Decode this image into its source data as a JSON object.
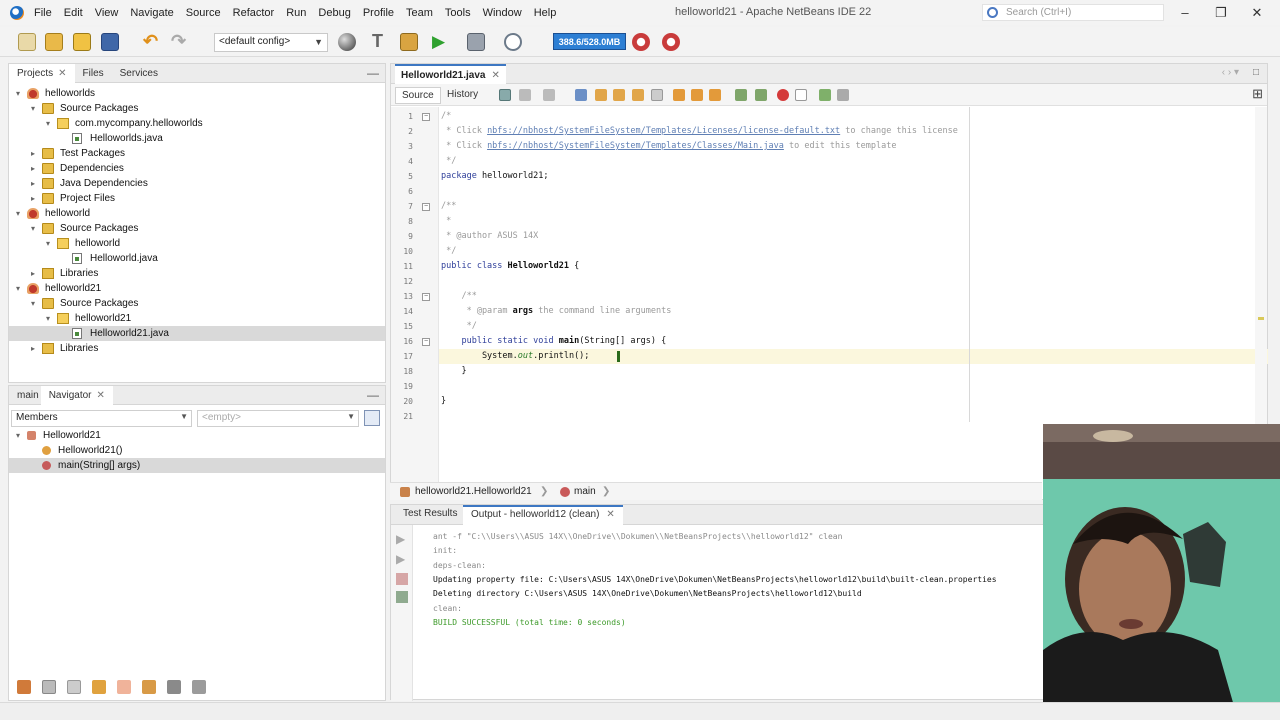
{
  "window": {
    "title": "helloworld21 - Apache NetBeans IDE 22",
    "search_placeholder": "Search (Ctrl+I)"
  },
  "menu": [
    "File",
    "Edit",
    "View",
    "Navigate",
    "Source",
    "Refactor",
    "Run",
    "Debug",
    "Profile",
    "Team",
    "Tools",
    "Window",
    "Help"
  ],
  "toolbar": {
    "config": "<default config>",
    "memory": "388.6/528.0MB"
  },
  "projects": {
    "tabs": [
      "Projects",
      "Files",
      "Services"
    ],
    "tree": [
      {
        "label": "helloworlds",
        "type": "proj",
        "depth": 0,
        "open": true
      },
      {
        "label": "Source Packages",
        "type": "folder",
        "depth": 1,
        "open": true
      },
      {
        "label": "com.mycompany.helloworlds",
        "type": "pkg",
        "depth": 2,
        "open": true
      },
      {
        "label": "Helloworlds.java",
        "type": "file",
        "depth": 3
      },
      {
        "label": "Test Packages",
        "type": "folder",
        "depth": 1,
        "open": false
      },
      {
        "label": "Dependencies",
        "type": "folder",
        "depth": 1,
        "open": false
      },
      {
        "label": "Java Dependencies",
        "type": "folder",
        "depth": 1,
        "open": false
      },
      {
        "label": "Project Files",
        "type": "folder",
        "depth": 1,
        "open": false
      },
      {
        "label": "helloworld",
        "type": "proj",
        "depth": 0,
        "open": true
      },
      {
        "label": "Source Packages",
        "type": "folder",
        "depth": 1,
        "open": true
      },
      {
        "label": "helloworld",
        "type": "pkg",
        "depth": 2,
        "open": true
      },
      {
        "label": "Helloworld.java",
        "type": "file",
        "depth": 3
      },
      {
        "label": "Libraries",
        "type": "lib",
        "depth": 1,
        "open": false
      },
      {
        "label": "helloworld21",
        "type": "proj",
        "depth": 0,
        "open": true
      },
      {
        "label": "Source Packages",
        "type": "folder",
        "depth": 1,
        "open": true
      },
      {
        "label": "helloworld21",
        "type": "pkg",
        "depth": 2,
        "open": true
      },
      {
        "label": "Helloworld21.java",
        "type": "file",
        "depth": 3,
        "selected": true
      },
      {
        "label": "Libraries",
        "type": "lib",
        "depth": 1,
        "open": false
      }
    ]
  },
  "navigator": {
    "tabs": [
      "main",
      "Navigator"
    ],
    "filter": "Members",
    "scope": "<empty>",
    "tree": [
      {
        "label": "Helloworld21",
        "depth": 0
      },
      {
        "label": "Helloworld21()",
        "depth": 1
      },
      {
        "label": "main(String[] args)",
        "depth": 1,
        "selected": true
      }
    ]
  },
  "editor": {
    "file_tab": "Helloworld21.java",
    "view_tabs": [
      "Source",
      "History"
    ],
    "lines": [
      {
        "n": "1",
        "fold": "−",
        "html": "<span class='c-com'>/*</span>"
      },
      {
        "n": "2",
        "html": "<span class='c-com'> * Click </span><span class='c-link'>nbfs://nbhost/SystemFileSystem/Templates/Licenses/license-default.txt</span><span class='c-com'> to change this license</span>"
      },
      {
        "n": "3",
        "html": "<span class='c-com'> * Click </span><span class='c-link'>nbfs://nbhost/SystemFileSystem/Templates/Classes/Main.java</span><span class='c-com'> to edit this template</span>"
      },
      {
        "n": "4",
        "html": "<span class='c-com'> */</span>"
      },
      {
        "n": "5",
        "html": "<span class='c-kw'>package</span> helloworld21;"
      },
      {
        "n": "6",
        "html": ""
      },
      {
        "n": "7",
        "fold": "−",
        "html": "<span class='c-com'>/**</span>"
      },
      {
        "n": "8",
        "html": "<span class='c-com'> *</span>"
      },
      {
        "n": "9",
        "html": "<span class='c-com'> * @author ASUS 14X</span>"
      },
      {
        "n": "10",
        "html": "<span class='c-com'> */</span>"
      },
      {
        "n": "11",
        "html": "<span class='c-kw'>public class</span> <span class='c-b'>Helloworld21</span> {"
      },
      {
        "n": "12",
        "html": ""
      },
      {
        "n": "13",
        "fold": "−",
        "html": "    <span class='c-com'>/**</span>"
      },
      {
        "n": "14",
        "html": "<span class='c-com'>     * @param </span><span class='c-b'>args</span><span class='c-com'> the command line arguments</span>"
      },
      {
        "n": "15",
        "html": "<span class='c-com'>     */</span>"
      },
      {
        "n": "16",
        "fold": "−",
        "html": "    <span class='c-kw'>public static void</span> <span class='c-b'>main</span>(String[] args) {"
      },
      {
        "n": "17",
        "cur": true,
        "html": "        System.<span class='c-field'>out</span>.println();"
      },
      {
        "n": "18",
        "html": "    }"
      },
      {
        "n": "19",
        "html": ""
      },
      {
        "n": "20",
        "html": "}"
      },
      {
        "n": "21",
        "html": ""
      }
    ]
  },
  "breadcrumb": {
    "class": "helloworld21.Helloworld21",
    "method": "main"
  },
  "output": {
    "tabs": [
      "Test Results",
      "Output - helloworld12 (clean)"
    ],
    "lines": [
      {
        "t": "ant -f \"C:\\\\Users\\\\ASUS 14X\\\\OneDrive\\\\Dokumen\\\\NetBeansProjects\\\\helloworld12\" clean",
        "cls": "dim"
      },
      {
        "t": "init:",
        "cls": "dim"
      },
      {
        "t": "deps-clean:",
        "cls": "dim"
      },
      {
        "t": "Updating property file: C:\\Users\\ASUS 14X\\OneDrive\\Dokumen\\NetBeansProjects\\helloworld12\\build\\built-clean.properties",
        "cls": ""
      },
      {
        "t": "Deleting directory C:\\Users\\ASUS 14X\\OneDrive\\Dokumen\\NetBeansProjects\\helloworld12\\build",
        "cls": ""
      },
      {
        "t": "clean:",
        "cls": "dim"
      },
      {
        "t": "BUILD SUCCESSFUL (total time: 0 seconds)",
        "cls": "ok"
      }
    ]
  }
}
